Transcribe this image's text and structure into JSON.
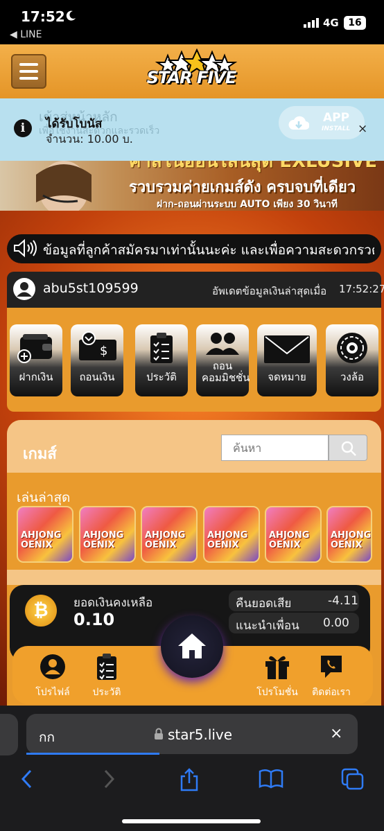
{
  "status": {
    "time": "17:52",
    "back_label": "◀ LINE",
    "network": "4G",
    "battery": "16"
  },
  "header": {
    "logo_text": "STAR FIVE"
  },
  "toast": {
    "title": "ได้รับโบนัส",
    "amount": "จำนวน: 10.00 บ.",
    "bg_line1": "เข้าสู่หน้าหลัก",
    "bg_line2": "เพื่อใช้งานสะดวกและรวดเร็ว",
    "app_label": "APP",
    "app_sub": "INSTALL",
    "close": "×"
  },
  "banner": {
    "line1": "คาสิโนออนไลน์สุด EXLUSIVE",
    "line2": "รวบรวมค่ายเกมส์ดัง ครบจบที่เดียว",
    "line3": "ฝาก-ถอนผ่านระบบ AUTO เพียง 30 วินาที"
  },
  "ticker": {
    "text": "ข้อมูลที่ลูกค้าสมัครมาเท่านั้นนะค่ะ และเพื่อความสะดวกรวดเร็ว"
  },
  "user": {
    "username": "abu5st109599",
    "update_label": "อัพเดตข้อมูลเงินล่าสุดเมื่อ",
    "update_time": "17:52:27"
  },
  "actions": [
    {
      "label": "ฝากเงิน",
      "icon": "wallet-icon"
    },
    {
      "label": "ถอนเงิน",
      "icon": "cash-icon"
    },
    {
      "label": "ประวัติ",
      "icon": "clipboard-icon"
    },
    {
      "label": "ถอนคอมมิชชั่น",
      "icon": "users-icon"
    },
    {
      "label": "จดหมาย",
      "icon": "mail-icon"
    },
    {
      "label": "วงล้อ",
      "icon": "wheel-icon"
    }
  ],
  "games": {
    "title": "เกมส์",
    "search_placeholder": "ค้นหา",
    "recent_label": "เล่นล่าสุด",
    "recent": [
      {
        "title": "AHJONG\nOENIX"
      },
      {
        "title": "AHJONG\nOENIX"
      },
      {
        "title": "AHJONG\nOENIX"
      },
      {
        "title": "AHJONG\nOENIX"
      },
      {
        "title": "AHJONG\nOENIX"
      },
      {
        "title": "AHJONG\nOENIX"
      }
    ]
  },
  "balance": {
    "label": "ยอดเงินคงเหลือ",
    "value": "0.10",
    "cashback_label": "คืนยอดเสีย",
    "cashback_value": "-4.11",
    "referral_label": "แนะนำเพื่อน",
    "referral_value": "0.00"
  },
  "bottom_nav": {
    "profile": "โปรไฟล์",
    "history": "ประวัติ",
    "promotion": "โปรโมชั่น",
    "contact": "ติดต่อเรา"
  },
  "browser": {
    "aa": "กก",
    "url": "star5.live",
    "close": "×"
  },
  "colors": {
    "accent": "#e99b2d",
    "header": "#f3b04a",
    "toast": "#b8e0ef",
    "link_blue": "#2f7bf6"
  }
}
